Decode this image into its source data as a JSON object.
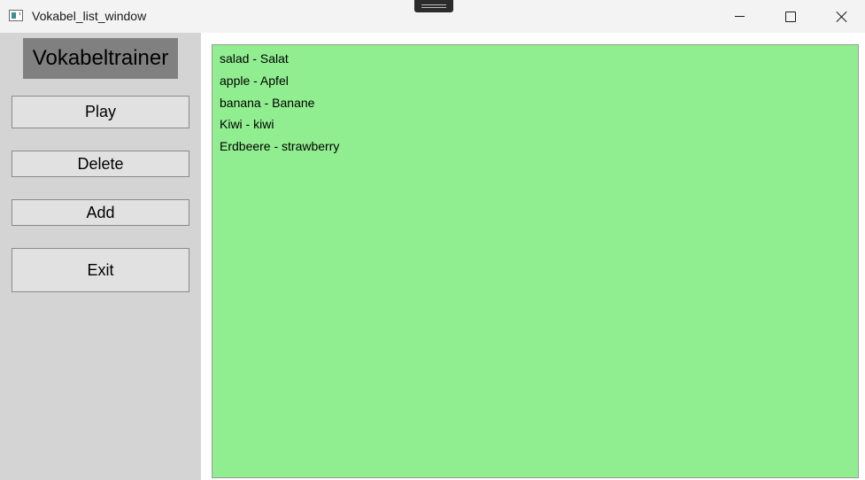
{
  "window": {
    "title": "Vokabel_list_window",
    "icon": "app-window-icon",
    "controls": [
      "minimize-icon",
      "maximize-icon",
      "close-icon"
    ]
  },
  "sidebar": {
    "heading": "Vokabeltrainer",
    "buttons": {
      "play": "Play",
      "delete": "Delete",
      "add": "Add",
      "exit": "Exit"
    }
  },
  "vocab_list": {
    "items": [
      "salad - Salat",
      "apple - Apfel",
      "banana - Banane",
      "Kiwi - kiwi",
      "Erdbeere - strawberry"
    ]
  },
  "colors": {
    "sidebar_bg": "#d4d4d4",
    "heading_bg": "#808080",
    "list_bg": "#90ee90",
    "button_bg": "#e1e1e1"
  }
}
